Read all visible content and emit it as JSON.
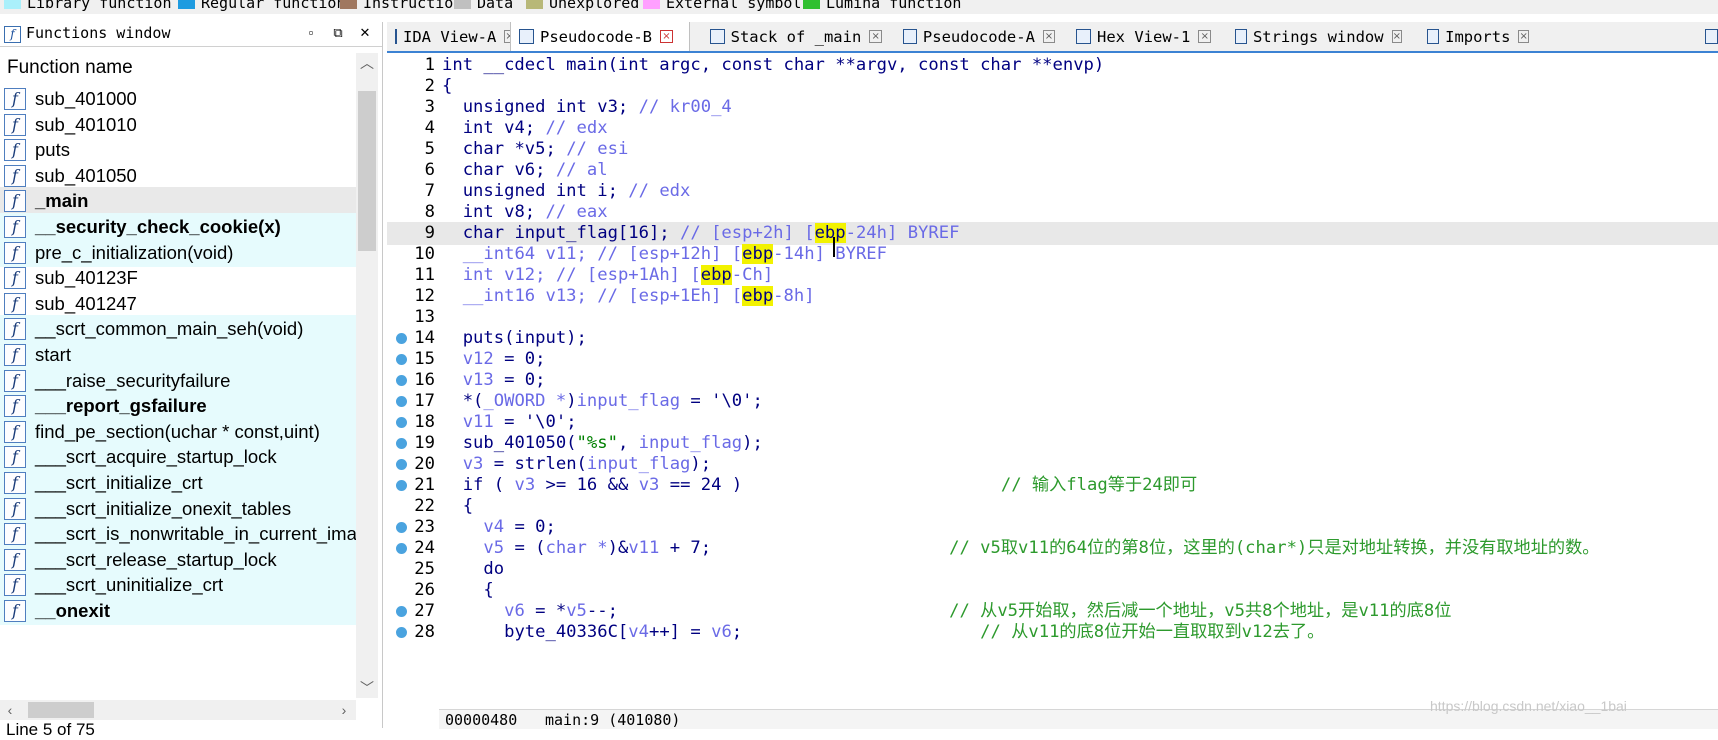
{
  "legend": [
    {
      "label": "Library function",
      "color": "#aaf0fb"
    },
    {
      "label": "Regular function",
      "color": "#1e9be0"
    },
    {
      "label": "Instruction",
      "color": "#a07860"
    },
    {
      "label": "Data",
      "color": "#c0c0c0"
    },
    {
      "label": "Unexplored",
      "color": "#b8b878"
    },
    {
      "label": "External symbol",
      "color": "#ffa0ff"
    },
    {
      "label": "Lumina function",
      "color": "#30c030"
    }
  ],
  "functions_window": {
    "title": "Functions window",
    "column_header": "Function name",
    "functions": [
      {
        "name": "sub_401000",
        "style": "plain"
      },
      {
        "name": "sub_401010",
        "style": "plain"
      },
      {
        "name": "puts",
        "style": "plain"
      },
      {
        "name": "sub_401050",
        "style": "plain"
      },
      {
        "name": "_main",
        "style": "selected"
      },
      {
        "name": "__security_check_cookie(x)",
        "style": "lib-bold"
      },
      {
        "name": "pre_c_initialization(void)",
        "style": "lib"
      },
      {
        "name": "sub_40123F",
        "style": "plain"
      },
      {
        "name": "sub_401247",
        "style": "plain"
      },
      {
        "name": "__scrt_common_main_seh(void)",
        "style": "lib"
      },
      {
        "name": "start",
        "style": "lib"
      },
      {
        "name": "___raise_securityfailure",
        "style": "lib"
      },
      {
        "name": "___report_gsfailure",
        "style": "lib-bold"
      },
      {
        "name": "find_pe_section(uchar * const,uint)",
        "style": "lib"
      },
      {
        "name": "___scrt_acquire_startup_lock",
        "style": "lib"
      },
      {
        "name": "___scrt_initialize_crt",
        "style": "lib"
      },
      {
        "name": "___scrt_initialize_onexit_tables",
        "style": "lib"
      },
      {
        "name": "___scrt_is_nonwritable_in_current_ima",
        "style": "lib"
      },
      {
        "name": "___scrt_release_startup_lock",
        "style": "lib"
      },
      {
        "name": "___scrt_uninitialize_crt",
        "style": "lib"
      },
      {
        "name": "__onexit",
        "style": "lib-bold"
      }
    ],
    "status": "Line 5 of 75"
  },
  "tabs": [
    {
      "label": "IDA View-A",
      "active": false
    },
    {
      "label": "Pseudocode-B",
      "active": true
    },
    {
      "label": "Stack of _main",
      "active": false
    },
    {
      "label": "Pseudocode-A",
      "active": false
    },
    {
      "label": "Hex View-1",
      "active": false
    },
    {
      "label": "Strings window",
      "active": false
    },
    {
      "label": "Imports",
      "active": false
    }
  ],
  "code_lines": [
    {
      "n": "1",
      "dot": false,
      "hl": false,
      "html": "<span class=\"kw\">int __cdecl main(int argc, const char **argv, const char **envp)</span>"
    },
    {
      "n": "2",
      "dot": false,
      "hl": false,
      "html": "<span class=\"kw\">{</span>"
    },
    {
      "n": "3",
      "dot": false,
      "hl": false,
      "html": "  <span class=\"kw\">unsigned int v3;</span> <span class=\"cm\">// kr00_4</span>"
    },
    {
      "n": "4",
      "dot": false,
      "hl": false,
      "html": "  <span class=\"kw\">int v4;</span> <span class=\"cm\">// edx</span>"
    },
    {
      "n": "5",
      "dot": false,
      "hl": false,
      "html": "  <span class=\"kw\">char *v5;</span> <span class=\"cm\">// esi</span>"
    },
    {
      "n": "6",
      "dot": false,
      "hl": false,
      "html": "  <span class=\"kw\">char v6;</span> <span class=\"cm\">// al</span>"
    },
    {
      "n": "7",
      "dot": false,
      "hl": false,
      "html": "  <span class=\"kw\">unsigned int i;</span> <span class=\"cm\">// edx</span>"
    },
    {
      "n": "8",
      "dot": false,
      "hl": false,
      "html": "  <span class=\"kw\">int v8;</span> <span class=\"cm\">// eax</span>"
    },
    {
      "n": "9",
      "dot": false,
      "hl": true,
      "html": "  <span class=\"kw\">char input_flag[16];</span> <span class=\"cm\">// [esp+2h] [<span class=\"yl\">ebp</span>-24h] BYREF</span>"
    },
    {
      "n": "10",
      "dot": false,
      "hl": false,
      "html": "  <span class=\"cm\">__int64 v11;</span> <span class=\"cm\">// [esp+12h] [<span class=\"yl\">ebp</span>-14h] BYREF</span>"
    },
    {
      "n": "11",
      "dot": false,
      "hl": false,
      "html": "  <span class=\"cm\">int v12;</span> <span class=\"cm\">// [esp+1Ah] [<span class=\"yl\">ebp</span>-Ch]</span>"
    },
    {
      "n": "12",
      "dot": false,
      "hl": false,
      "html": "  <span class=\"cm\">__int16 v13;</span> <span class=\"cm\">// [esp+1Eh] [<span class=\"yl\">ebp</span>-8h]</span>"
    },
    {
      "n": "13",
      "dot": false,
      "hl": false,
      "html": ""
    },
    {
      "n": "14",
      "dot": true,
      "hl": false,
      "html": "  <span class=\"kw\">puts(input);</span>"
    },
    {
      "n": "15",
      "dot": true,
      "hl": false,
      "html": "  <span class=\"vr\">v12</span> <span class=\"kw\">= 0;</span>"
    },
    {
      "n": "16",
      "dot": true,
      "hl": false,
      "html": "  <span class=\"vr\">v13</span> <span class=\"kw\">= 0;</span>"
    },
    {
      "n": "17",
      "dot": true,
      "hl": false,
      "html": "  <span class=\"kw\">*(</span><span class=\"cm\">_OWORD *</span><span class=\"kw\">)</span><span class=\"vr\">input_flag</span> <span class=\"kw\">= '\\0';</span>"
    },
    {
      "n": "18",
      "dot": true,
      "hl": false,
      "html": "  <span class=\"vr\">v11</span> <span class=\"kw\">= '\\0';</span>"
    },
    {
      "n": "19",
      "dot": true,
      "hl": false,
      "html": "  <span class=\"kw\">sub_401050(</span><span class=\"st\">\"%s\"</span><span class=\"kw\">,</span> <span class=\"vr\">input_flag</span><span class=\"kw\">);</span>"
    },
    {
      "n": "20",
      "dot": true,
      "hl": false,
      "html": "  <span class=\"vr\">v3</span> <span class=\"kw\">= strlen(</span><span class=\"vr\">input_flag</span><span class=\"kw\">);</span>"
    },
    {
      "n": "21",
      "dot": true,
      "hl": false,
      "html": "  <span class=\"kw\">if (</span> <span class=\"vr\">v3</span> <span class=\"kw\">&gt;= 16 &amp;&amp;</span> <span class=\"vr\">v3</span> <span class=\"kw\">== 24 )</span>                         <span class=\"gc\">// 输入flag等于24即可</span>"
    },
    {
      "n": "22",
      "dot": false,
      "hl": false,
      "html": "  <span class=\"kw\">{</span>"
    },
    {
      "n": "23",
      "dot": true,
      "hl": false,
      "html": "    <span class=\"vr\">v4</span> <span class=\"kw\">= 0;</span>"
    },
    {
      "n": "24",
      "dot": true,
      "hl": false,
      "html": "    <span class=\"vr\">v5</span> <span class=\"kw\">= (</span><span class=\"cm\">char *</span><span class=\"kw\">)&amp;</span><span class=\"vr\">v11</span> <span class=\"kw\">+ 7;</span>                       <span class=\"gc\">// v5取v11的64位的第8位，这里的(char*)只是对地址转换，并没有取地址的数。</span>"
    },
    {
      "n": "25",
      "dot": false,
      "hl": false,
      "html": "    <span class=\"kw\">do</span>"
    },
    {
      "n": "26",
      "dot": false,
      "hl": false,
      "html": "    <span class=\"kw\">{</span>"
    },
    {
      "n": "27",
      "dot": true,
      "hl": false,
      "html": "      <span class=\"vr\">v6</span> <span class=\"kw\">= *</span><span class=\"vr\">v5</span><span class=\"kw\">--;</span>                                <span class=\"gc\">// 从v5开始取，然后减一个地址，v5共8个地址，是v11的底8位</span>"
    },
    {
      "n": "28",
      "dot": true,
      "hl": false,
      "html": "      <span class=\"kw\">byte_40336C[</span><span class=\"vr\">v4</span><span class=\"kw\">++] =</span> <span class=\"vr\">v6</span><span class=\"kw\">;</span>                       <span class=\"gc\">// 从v11的底8位开始一直取取到v12去了。</span>"
    }
  ],
  "code_status": {
    "offset": "00000480",
    "location": "main:9 (401080)"
  },
  "watermark": "https://blog.csdn.net/xiao__1bai"
}
